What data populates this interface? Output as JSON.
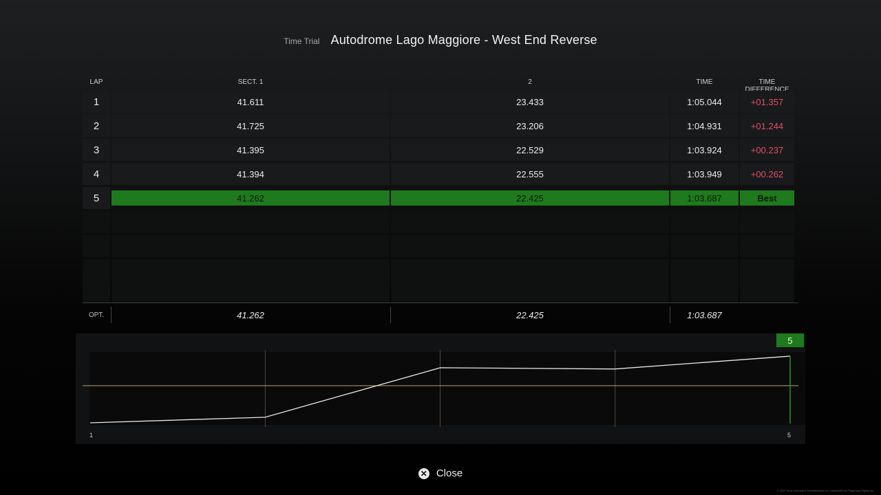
{
  "header": {
    "mode": "Time Trial",
    "track": "Autodrome Lago Maggiore - West End Reverse"
  },
  "columns": {
    "lap": "LAP",
    "sect1": "SECT. 1",
    "sect2": "2",
    "time": "TIME",
    "diff": "TIME DIFFERENCE"
  },
  "laps": [
    {
      "lap": "1",
      "s1": "41.611",
      "s2": "23.433",
      "time": "1:05.044",
      "diff": "+01.357"
    },
    {
      "lap": "2",
      "s1": "41.725",
      "s2": "23.206",
      "time": "1:04.931",
      "diff": "+01.244"
    },
    {
      "lap": "3",
      "s1": "41.395",
      "s2": "22.529",
      "time": "1:03.924",
      "diff": "+00.237"
    },
    {
      "lap": "4",
      "s1": "41.394",
      "s2": "22.555",
      "time": "1:03.949",
      "diff": "+00.262"
    },
    {
      "lap": "5",
      "s1": "41.262",
      "s2": "22.425",
      "time": "1:03.687",
      "diff": "Best"
    }
  ],
  "optimal": {
    "label": "OPT.",
    "s1": "41.262",
    "s2": "22.425",
    "time": "1:03.687"
  },
  "graph": {
    "selected_lap": "5",
    "x_start_label": "1",
    "x_end_label": "5",
    "lap_times_seconds": [
      65.044,
      64.931,
      63.924,
      63.949,
      63.687
    ],
    "colors": {
      "line": "#e8e8e8",
      "reference": "#b8a86a",
      "selected": "#1e7a1c"
    }
  },
  "footer": {
    "close_icon": "cross-button-icon",
    "close_label": "Close",
    "copyright": "© 2022 Sony Interactive Entertainment Inc. Developed by Polyphony Digital Inc."
  },
  "colors": {
    "best_row": "#1e7a1c",
    "diff_text": "#e0506a"
  }
}
